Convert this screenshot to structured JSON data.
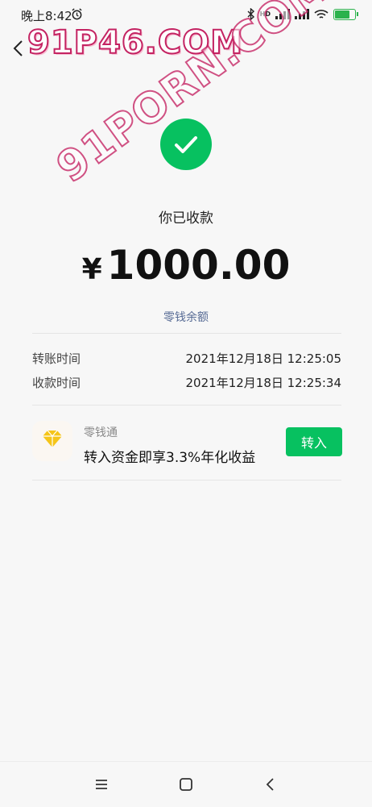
{
  "status_bar": {
    "time": "晚上8:42",
    "network_label": "HD"
  },
  "watermark": {
    "line1": "91P46.COM",
    "line2": "91PORN.COM"
  },
  "receipt": {
    "title": "你已收款",
    "currency": "¥",
    "amount": "1000.00",
    "balance_link": "零钱余额"
  },
  "details": [
    {
      "label": "转账时间",
      "value": "2021年12月18日 12:25:05"
    },
    {
      "label": "收款时间",
      "value": "2021年12月18日 12:25:34"
    }
  ],
  "promo": {
    "name": "零钱通",
    "description": "转入资金即享3.3%年化收益",
    "button": "转入"
  },
  "colors": {
    "accent": "#07c160",
    "link": "#576b95",
    "watermark": "#c2185b"
  },
  "icons": [
    "alarm-icon",
    "bluetooth-icon",
    "signal-icon",
    "wifi-icon",
    "battery-icon",
    "back-icon",
    "check-icon",
    "diamond-icon",
    "menu-icon",
    "home-icon",
    "nav-back-icon"
  ]
}
